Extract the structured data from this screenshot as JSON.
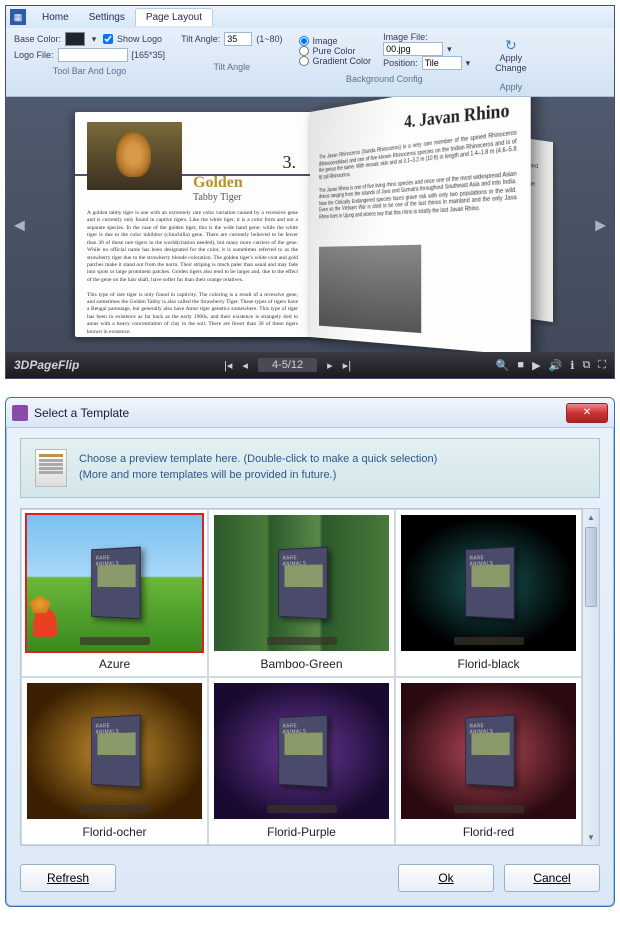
{
  "app": {
    "tabs": {
      "home": "Home",
      "settings": "Settings",
      "pageLayout": "Page Layout"
    },
    "ribbon": {
      "baseColor": {
        "label": "Base Color:",
        "value": "#1e2530"
      },
      "logoFile": {
        "label": "Logo File:",
        "browse": "[165*35]"
      },
      "showLogo": {
        "label": "Show Logo",
        "checked": true
      },
      "tiltAngle": {
        "label": "Tilt Angle:",
        "value": "35",
        "range": "(1~80)"
      },
      "bg": {
        "image": "Image",
        "pureColor": "Pure Color",
        "gradient": "Gradient Color",
        "imageFile": "Image File:",
        "imageValue": "00.jpg",
        "position": "Position:",
        "positionValue": "Tile"
      },
      "apply": {
        "label1": "Apply",
        "label2": "Change"
      },
      "groups": {
        "g1": "Tool Bar And Logo",
        "g2": "Tilt Angle",
        "g3": "Background Config",
        "g4": "Apply"
      }
    },
    "brand": "3DPageFlip",
    "pageIndicator": "4-5/12",
    "book": {
      "leftNum": "3.",
      "leftTitle": "Golden",
      "leftSub": "Tabby Tiger",
      "leftBody1": "A golden tabby tiger is one with an extremely rare color variation caused by a recessive gene and is currently only found in captive tigers. Like the white tiger, it is a color form and not a separate species. In the case of the golden tiger, this is the wide band gene; while the white tiger is due to the color inhibitor (chinchilla) gene. There are currently believed to be fewer than 30 of these rare tigers in the world(citation needed), but many more carriers of the gene. While no official name has been designated for the color, it is sometimes referred to as the strawberry tiger due to the strawberry blonde coloration. The golden tiger's white coat and gold patches make it stand out from the norm. Their striping is much paler than usual and may fade into spots or large prominent patches. Golden tigers also tend to be larger and, due to the effect of the gene on the hair shaft, have softer fur than their orange relatives.",
      "leftBody2": "This type of rare tiger is only found in captivity. The coloring is a result of a recessive gene, and sometimes the Golden Tabby is also called the Strawberry Tiger. These types of tigers have a Bengal parentage, but generally also have Amur tiger genetics somewhere. This type of tiger has been in existence as far back as the early 1900s, and their existence is strangely tied to areas with a heavy concentration of clay in the soil. There are fewer than 30 of these tigers known in existence.",
      "rightTitle": "4. Javan Rhino"
    }
  },
  "dialog": {
    "title": "Select a Template",
    "info1": "Choose a preview template here. (Double-click to make a quick selection)",
    "info2": "(More and more templates will be provided in future.)",
    "templates": [
      {
        "name": "Azure",
        "bg": "bg-azure",
        "selected": true
      },
      {
        "name": "Bamboo-Green",
        "bg": "bg-bamboo",
        "selected": false
      },
      {
        "name": "Florid-black",
        "bg": "bg-fblack",
        "selected": false
      },
      {
        "name": "Florid-ocher",
        "bg": "bg-focher",
        "selected": false
      },
      {
        "name": "Florid-Purple",
        "bg": "bg-fpurple",
        "selected": false
      },
      {
        "name": "Florid-red",
        "bg": "bg-fred",
        "selected": false
      }
    ],
    "buttons": {
      "refresh": "Refresh",
      "ok": "Ok",
      "cancel": "Cancel"
    }
  }
}
